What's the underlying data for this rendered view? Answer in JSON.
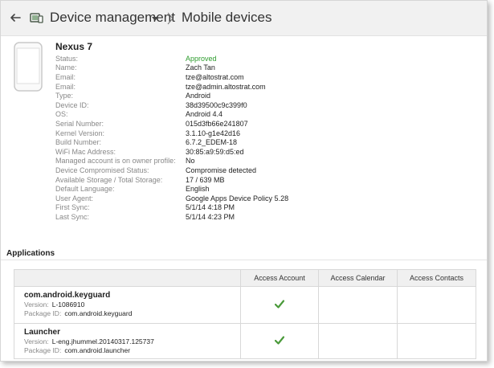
{
  "header": {
    "root_label": "Device management",
    "current_label": "Mobile devices"
  },
  "device": {
    "name": "Nexus 7",
    "properties": [
      {
        "label": "Status:",
        "value": "Approved"
      },
      {
        "label": "Name:",
        "value": "Zach Tan"
      },
      {
        "label": "Email:",
        "value": "tze@altostrat.com"
      },
      {
        "label": "Email:",
        "value": "tze@admin.altostrat.com"
      },
      {
        "label": "Type:",
        "value": "Android"
      },
      {
        "label": "Device ID:",
        "value": "38d39500c9c399f0"
      },
      {
        "label": "OS:",
        "value": "Android 4.4"
      },
      {
        "label": "Serial Number:",
        "value": "015d3fb66e241807"
      },
      {
        "label": "Kernel Version:",
        "value": "3.1.10-g1e42d16"
      },
      {
        "label": "Build Number:",
        "value": "6.7.2_EDEM-18"
      },
      {
        "label": "WiFi Mac Address:",
        "value": "30:85:a9:59:d5:ed"
      },
      {
        "label": "Managed account is on owner profile:",
        "value": "No"
      },
      {
        "label": "Device Compromised Status:",
        "value": "Compromise detected"
      },
      {
        "label": "Available Storage / Total Storage:",
        "value": "17 / 639 MB"
      },
      {
        "label": "Default Language:",
        "value": "English"
      },
      {
        "label": "User Agent:",
        "value": "Google Apps Device Policy 5.28"
      },
      {
        "label": "First Sync:",
        "value": "5/1/14 4:18 PM"
      },
      {
        "label": "Last Sync:",
        "value": "5/1/14 4:23 PM"
      }
    ]
  },
  "applications": {
    "heading": "Applications",
    "columns": [
      "",
      "Access Account",
      "Access Calendar",
      "Access Contacts"
    ],
    "version_label": "Version:",
    "package_label": "Package ID:",
    "rows": [
      {
        "name": "com.android.keyguard",
        "version": "L-1086910",
        "package": "com.android.keyguard",
        "access_account": true,
        "access_calendar": false,
        "access_contacts": false
      },
      {
        "name": "Launcher",
        "version": "L-eng.jhummel.20140317.125737",
        "package": "com.android.launcher",
        "access_account": true,
        "access_calendar": false,
        "access_contacts": false
      }
    ]
  },
  "colors": {
    "approved": "#2e9c2e",
    "check": "#4a9a3a",
    "header_bg": "#f1f1f1"
  }
}
